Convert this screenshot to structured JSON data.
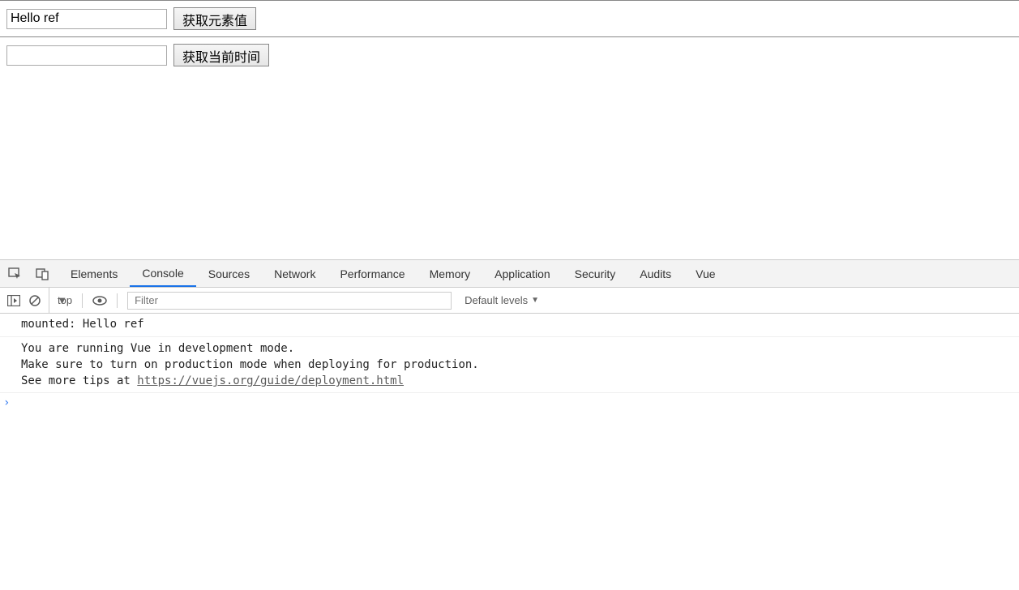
{
  "form": {
    "input1_value": "Hello ref",
    "button1_label": "获取元素值",
    "input2_value": "",
    "button2_label": "获取当前时间"
  },
  "devtools": {
    "tabs": [
      "Elements",
      "Console",
      "Sources",
      "Network",
      "Performance",
      "Memory",
      "Application",
      "Security",
      "Audits",
      "Vue"
    ],
    "active_tab": "Console",
    "toolbar": {
      "context": "top",
      "filter_placeholder": "Filter",
      "levels": "Default levels"
    },
    "console": {
      "line1": "mounted: Hello ref",
      "warn1": "You are running Vue in development mode.",
      "warn2": "Make sure to turn on production mode when deploying for production.",
      "warn3_prefix": "See more tips at ",
      "warn3_link": "https://vuejs.org/guide/deployment.html",
      "prompt": "›"
    }
  }
}
